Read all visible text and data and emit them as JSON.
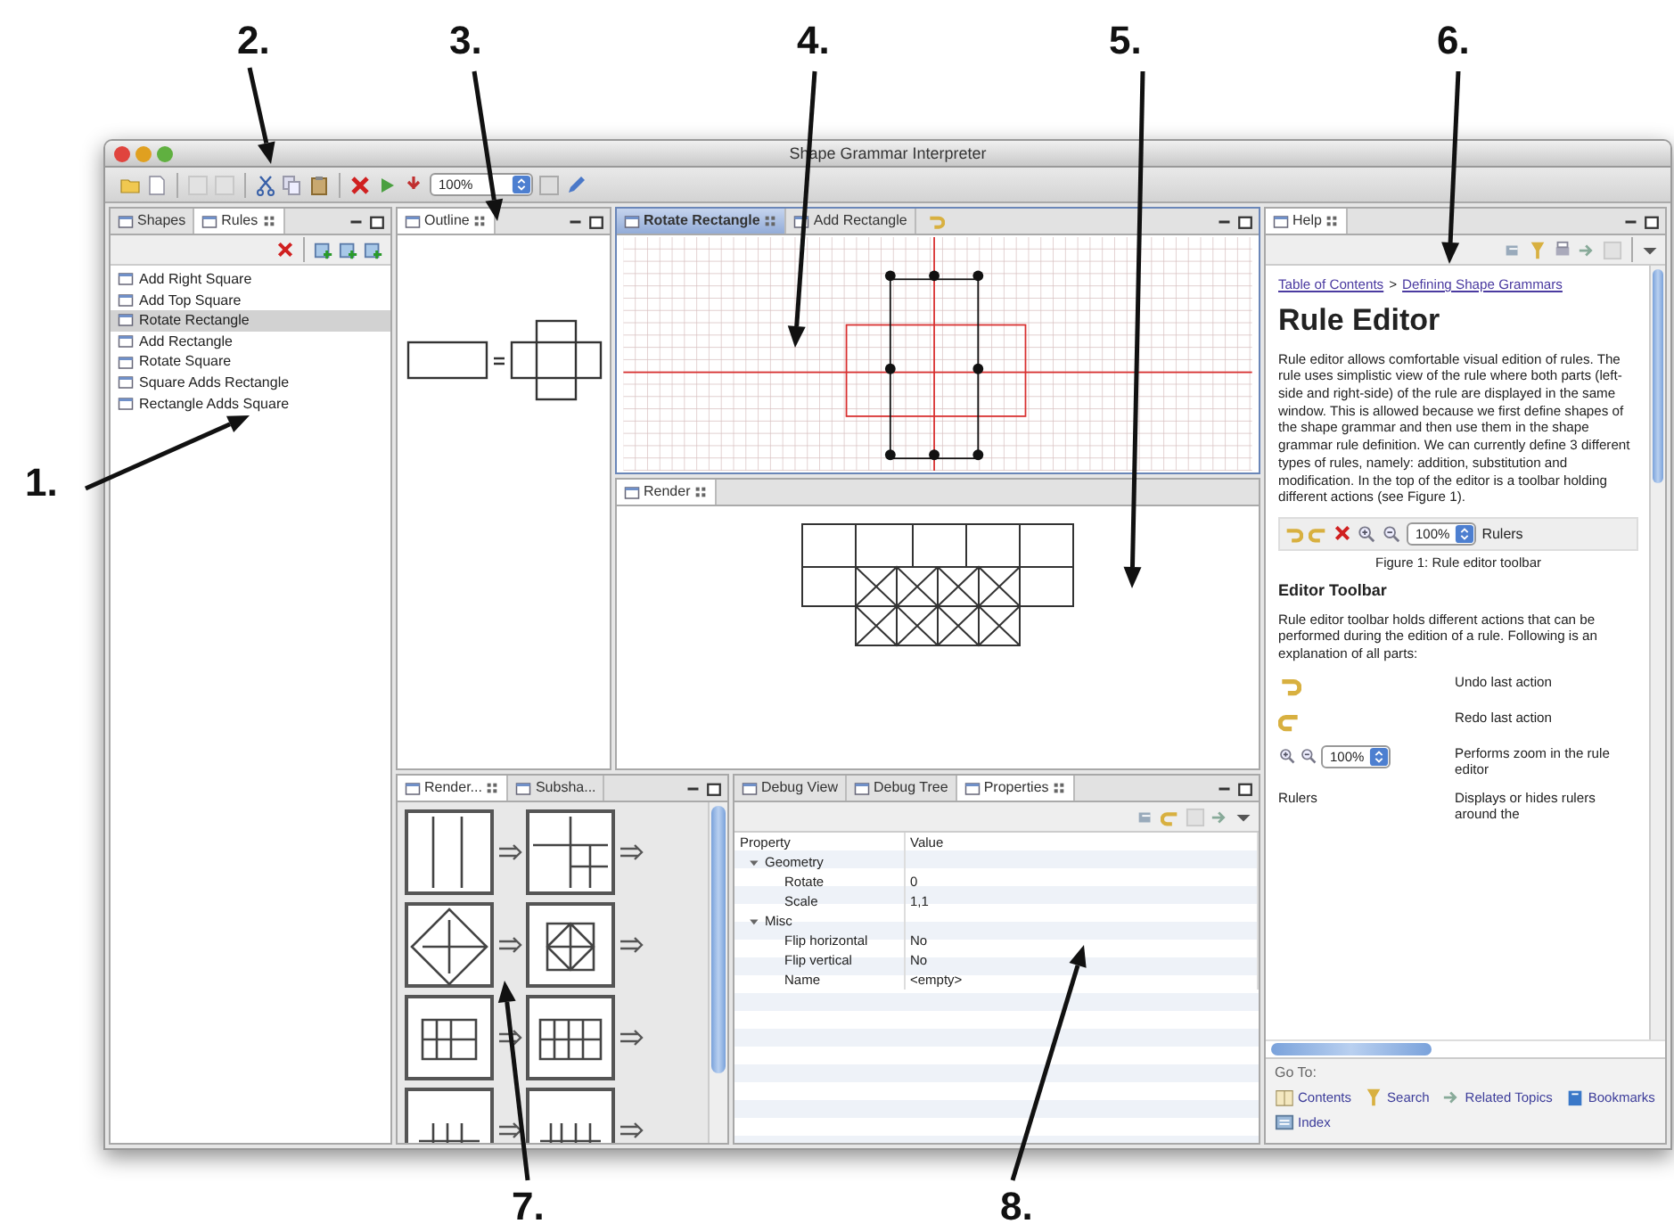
{
  "window": {
    "title": "Shape Grammar Interpreter"
  },
  "toolbar": {
    "zoom": "100%"
  },
  "rules_panel": {
    "tabs": [
      {
        "label": "Shapes",
        "selected": false
      },
      {
        "label": "Rules",
        "selected": true
      }
    ],
    "items": [
      {
        "label": "Add Right Square",
        "selected": false
      },
      {
        "label": "Add Top Square",
        "selected": false
      },
      {
        "label": "Rotate Rectangle",
        "selected": true
      },
      {
        "label": "Add Rectangle",
        "selected": false
      },
      {
        "label": "Rotate Square",
        "selected": false
      },
      {
        "label": "Square Adds Rectangle",
        "selected": false
      },
      {
        "label": "Rectangle Adds Square",
        "selected": false
      }
    ]
  },
  "outline_panel": {
    "tab": "Outline"
  },
  "editor": {
    "tabs": [
      {
        "label": "Rotate Rectangle",
        "selected": true
      },
      {
        "label": "Add Rectangle",
        "selected": false
      }
    ]
  },
  "render_panel": {
    "tab": "Render"
  },
  "rules_view": {
    "tabs": [
      {
        "label": "Render...",
        "selected": true
      },
      {
        "label": "Subsha...",
        "selected": false
      }
    ]
  },
  "properties_panel": {
    "tabs": [
      {
        "label": "Debug View",
        "selected": false
      },
      {
        "label": "Debug Tree",
        "selected": false
      },
      {
        "label": "Properties",
        "selected": true
      }
    ],
    "columns": [
      "Property",
      "Value"
    ],
    "rows": [
      {
        "label": "Geometry",
        "expanded": true,
        "children": [
          {
            "label": "Rotate",
            "value": "0"
          },
          {
            "label": "Scale",
            "value": "1,1"
          }
        ]
      },
      {
        "label": "Misc",
        "expanded": true,
        "children": [
          {
            "label": "Flip horizontal",
            "value": "No"
          },
          {
            "label": "Flip vertical",
            "value": "No"
          },
          {
            "label": "Name",
            "value": "<empty>"
          }
        ]
      }
    ]
  },
  "help": {
    "tab": "Help",
    "breadcrumb": [
      {
        "kind": "link",
        "text": "Table of Contents"
      },
      {
        "kind": "separator",
        "text": ">"
      },
      {
        "kind": "link",
        "text": "Defining Shape Grammars"
      }
    ],
    "title": "Rule Editor",
    "intro": "Rule editor allows comfortable visual edition of rules. The rule uses simplistic view of the rule where both parts (left-side and right-side) of the rule are displayed in the same window. This is allowed because we first define shapes of the shape grammar and then use them in the shape grammar rule definition. We can currently define 3 different types of rules, namely: addition, substitution and modification. In the top of the editor is a toolbar holding different actions (see Figure 1).",
    "figure": {
      "zoom": "100%",
      "rulers": "Rulers",
      "caption": "Figure 1: Rule editor toolbar"
    },
    "section": "Editor Toolbar",
    "body": "Rule editor toolbar holds different actions that can be performed during the edition of a rule. Following is an explanation of all parts:",
    "actions": [
      {
        "kind": "undo",
        "description": "Undo last action"
      },
      {
        "kind": "redo",
        "description": "Redo last action"
      },
      {
        "kind": "zoom",
        "zoom": "100%",
        "description": "Performs zoom in the rule editor"
      },
      {
        "kind": "label",
        "label": "Rulers",
        "description": "Displays or hides rulers around the"
      }
    ],
    "goto_label": "Go To:",
    "goto_links": [
      {
        "kind": "contents",
        "label": "Contents"
      },
      {
        "kind": "search",
        "label": "Search"
      },
      {
        "kind": "related",
        "label": "Related Topics"
      },
      {
        "kind": "bookmarks",
        "label": "Bookmarks"
      },
      {
        "kind": "index",
        "label": "Index"
      }
    ]
  },
  "annotations": [
    "1.",
    "2.",
    "3.",
    "4.",
    "5.",
    "6.",
    "7.",
    "8."
  ]
}
